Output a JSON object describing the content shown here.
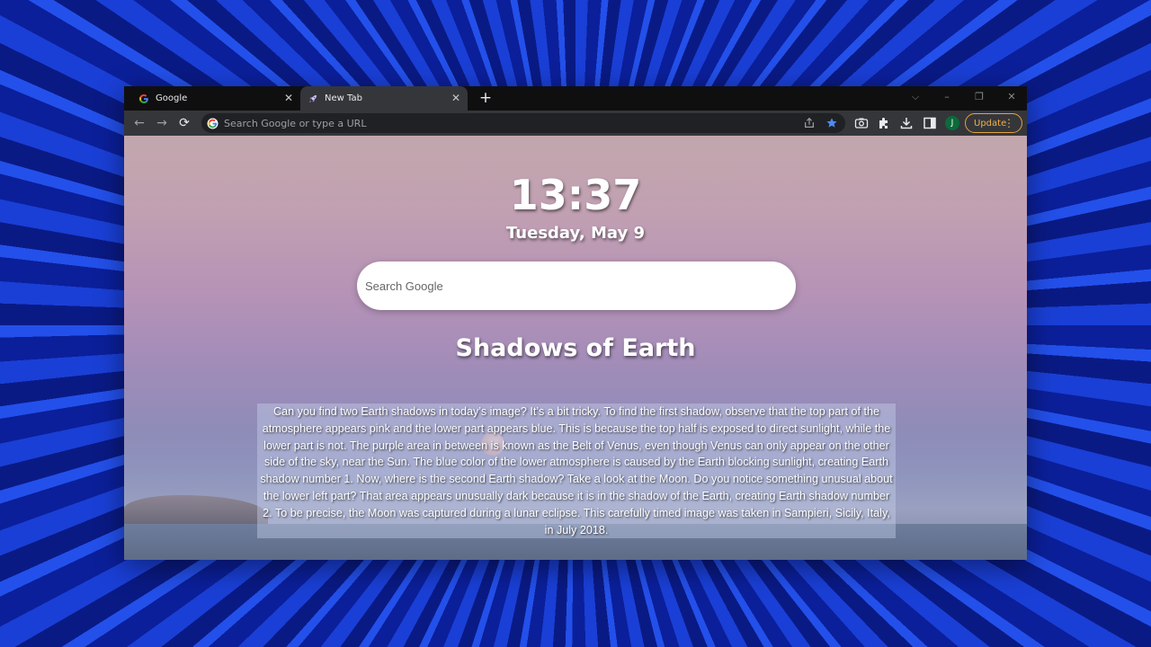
{
  "browser": {
    "tabs": [
      {
        "title": "Google",
        "favicon": "google-g-icon"
      },
      {
        "title": "New Tab",
        "favicon": "rocket-icon"
      }
    ],
    "new_tab_glyph": "+",
    "window_controls": {
      "dropdown": "⌵",
      "minimize": "–",
      "restore": "❐",
      "close": "✕"
    },
    "nav": {
      "back": "←",
      "forward": "→",
      "reload": "⟳"
    },
    "omnibox_placeholder": "Search Google or type a URL",
    "update_label": "Update",
    "avatar_initial": "J",
    "colors": {
      "accent_update": "#e6a23c",
      "bookmark_star": "#4c8bf5",
      "avatar": "#0b6b3a"
    }
  },
  "newtab": {
    "time": "13:37",
    "date": "Tuesday, May 9",
    "search_placeholder": "Search Google",
    "title": "Shadows of Earth",
    "description": "Can you find two Earth shadows in today’s image? It’s a bit tricky. To find the first shadow, observe that the top part of the atmosphere appears pink and the lower part appears blue. This is because the top half is exposed to direct sunlight, while the lower part is not. The purple area in between is known as the Belt of Venus, even though Venus can only appear on the other side of the sky, near the Sun. The blue color of the lower atmosphere is caused by the Earth blocking sunlight, creating Earth shadow number 1. Now, where is the second Earth shadow? Take a look at the Moon. Do you notice something unusual about the lower left part? That area appears unusually dark because it is in the shadow of the Earth, creating Earth shadow number 2. To be precise, the Moon was captured during a lunar eclipse. This carefully timed image was taken in Sampieri, Sicily, Italy, in July 2018."
  }
}
